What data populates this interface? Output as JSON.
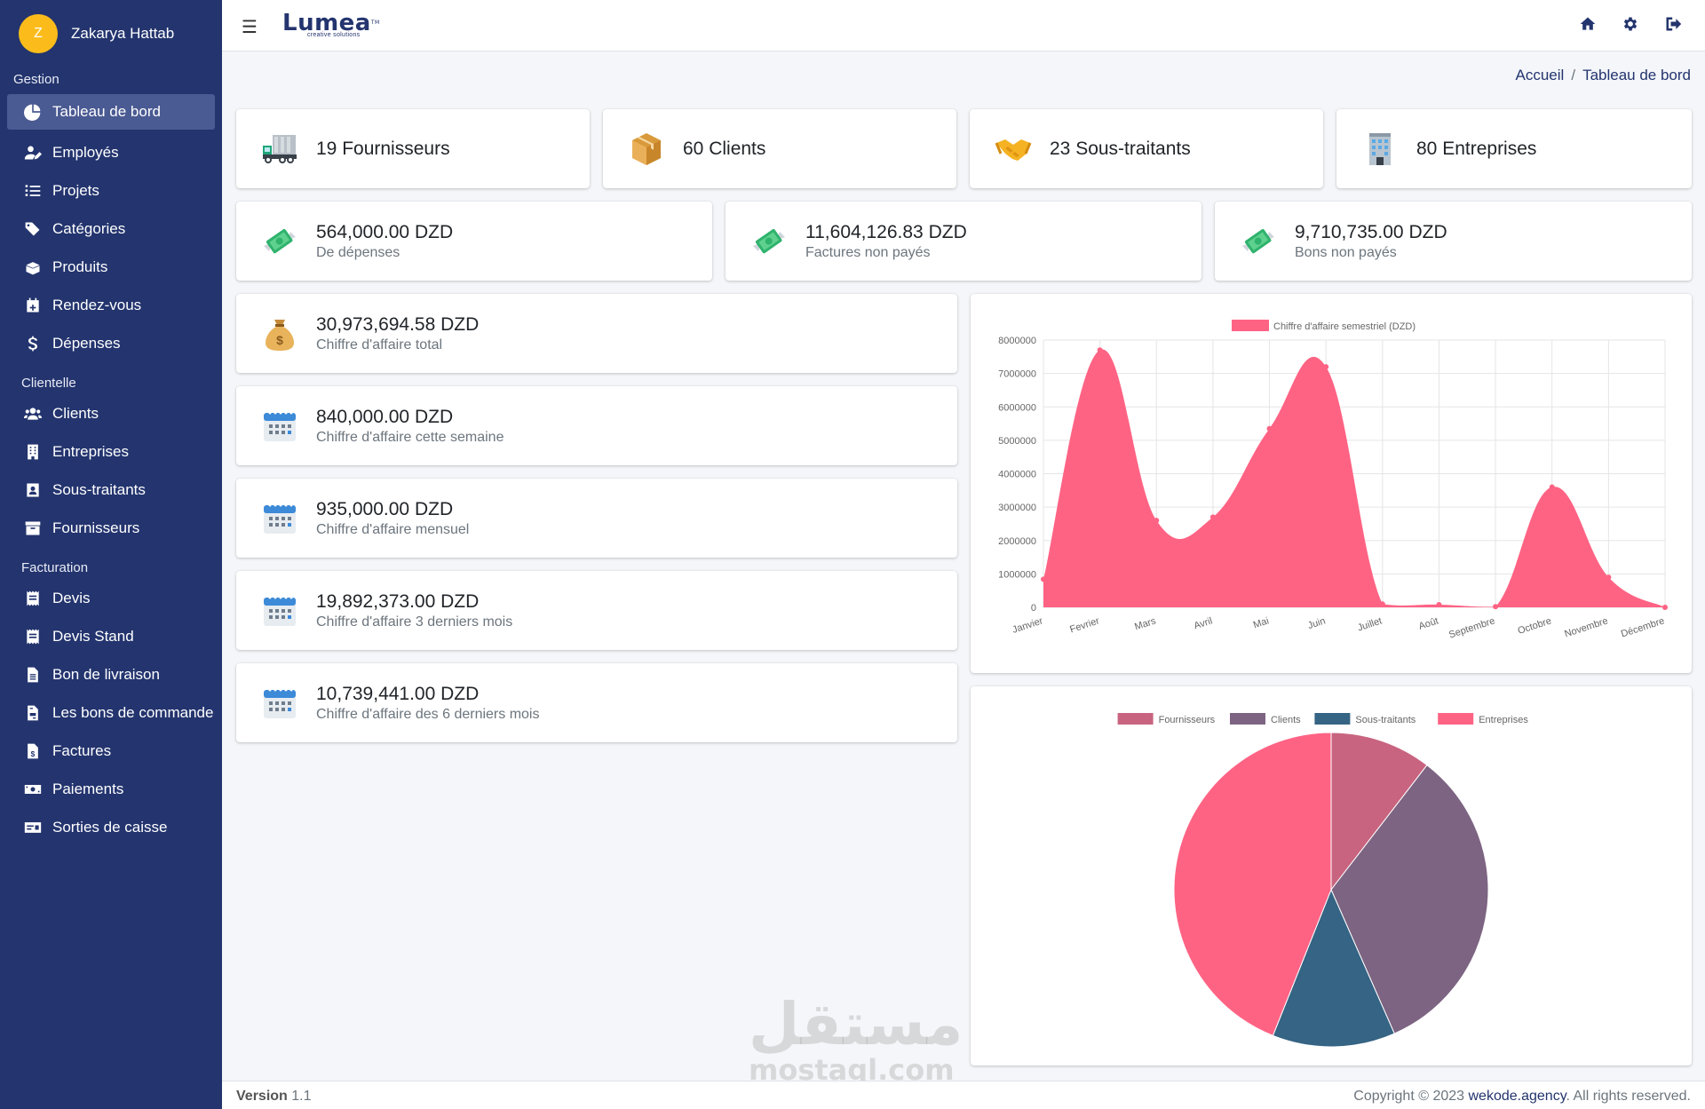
{
  "user": {
    "initial": "Z",
    "name": "Zakarya Hattab"
  },
  "sidebar": {
    "sections": [
      {
        "title": "Gestion",
        "items": [
          {
            "label": "Tableau de bord",
            "icon": "pie-chart-icon",
            "active": true
          },
          {
            "label": "Employés",
            "icon": "user-edit-icon"
          },
          {
            "label": "Projets",
            "icon": "tasks-icon"
          },
          {
            "label": "Catégories",
            "icon": "tags-icon"
          },
          {
            "label": "Produits",
            "icon": "box-open-icon"
          },
          {
            "label": "Rendez-vous",
            "icon": "calendar-plus-icon"
          },
          {
            "label": "Dépenses",
            "icon": "dollar-icon"
          }
        ]
      },
      {
        "title": "Clientelle",
        "items": [
          {
            "label": "Clients",
            "icon": "users-icon"
          },
          {
            "label": "Entreprises",
            "icon": "building-icon"
          },
          {
            "label": "Sous-traitants",
            "icon": "id-badge-icon"
          },
          {
            "label": "Fournisseurs",
            "icon": "archive-icon"
          }
        ]
      },
      {
        "title": "Facturation",
        "items": [
          {
            "label": "Devis",
            "icon": "receipt-icon"
          },
          {
            "label": "Devis Stand",
            "icon": "receipt-icon"
          },
          {
            "label": "Bon de livraison",
            "icon": "file-lines-icon"
          },
          {
            "label": "Les bons de commande",
            "icon": "file-invoice-icon"
          },
          {
            "label": "Factures",
            "icon": "file-invoice-dollar-icon"
          },
          {
            "label": "Paiements",
            "icon": "money-bill-icon"
          },
          {
            "label": "Sorties de caisse",
            "icon": "money-check-icon"
          }
        ]
      }
    ]
  },
  "topbar": {
    "logo": "Lumea",
    "logo_tm": "TM",
    "logo_sub": "creative solutions"
  },
  "breadcrumb": {
    "home": "Accueil",
    "separator": "/",
    "current": "Tableau de bord"
  },
  "stats_row1": [
    {
      "text": "19 Fournisseurs",
      "icon": "truck-icon"
    },
    {
      "text": "60 Clients",
      "icon": "box-icon"
    },
    {
      "text": "23 Sous-traitants",
      "icon": "handshake-icon"
    },
    {
      "text": "80 Entreprises",
      "icon": "office-building-icon"
    }
  ],
  "stats_row2": [
    {
      "amount": "564,000.00",
      "currency": "DZD",
      "label": "De dépenses",
      "icon": "money-wings-icon"
    },
    {
      "amount": "11,604,126.83",
      "currency": "DZD",
      "label": "Factures non payés",
      "icon": "money-wings-icon"
    },
    {
      "amount": "9,710,735.00",
      "currency": "DZD",
      "label": "Bons non payés",
      "icon": "money-wings-icon"
    }
  ],
  "stats_col": [
    {
      "amount": "30,973,694.58",
      "currency": "DZD",
      "label": "Chiffre d'affaire total",
      "icon": "money-bag-icon"
    },
    {
      "amount": "840,000.00",
      "currency": "DZD",
      "label": "Chiffre d'affaire cette semaine",
      "icon": "calendar-icon"
    },
    {
      "amount": "935,000.00",
      "currency": "DZD",
      "label": "Chiffre d'affaire mensuel",
      "icon": "calendar-icon"
    },
    {
      "amount": "19,892,373.00",
      "currency": "DZD",
      "label": "Chiffre d'affaire 3 derniers mois",
      "icon": "calendar-icon"
    },
    {
      "amount": "10,739,441.00",
      "currency": "DZD",
      "label": "Chiffre d'affaire des 6 derniers mois",
      "icon": "calendar-icon"
    }
  ],
  "chart_data": [
    {
      "type": "area",
      "title": "",
      "legend": "top",
      "grid": true,
      "series": [
        {
          "name": "Chiffre d'affaire semestriel (DZD)",
          "color": "#ff6384",
          "values": [
            840000,
            7700000,
            2600000,
            2700000,
            5350000,
            7200000,
            100000,
            80000,
            20000,
            3600000,
            900000,
            0
          ]
        }
      ],
      "categories": [
        "Janvier",
        "Fevrier",
        "Mars",
        "Avril",
        "Mai",
        "Juin",
        "Juillet",
        "Août",
        "Septembre",
        "Octobre",
        "Novembre",
        "Décembre"
      ],
      "ylim": [
        0,
        8000000
      ],
      "yticks": [
        "8000000",
        "7000000",
        "6000000",
        "5000000",
        "4000000",
        "3000000",
        "2000000",
        "1000000",
        "0"
      ]
    },
    {
      "type": "pie",
      "title": "",
      "legend": "top",
      "labels": [
        "Fournisseurs",
        "Clients",
        "Sous-traitants",
        "Entreprises"
      ],
      "values": [
        19,
        60,
        23,
        80
      ],
      "colors": [
        "#c8647f",
        "#7d6482",
        "#356484",
        "#ff6384"
      ]
    }
  ],
  "footer": {
    "version_label": "Version",
    "version": "1.1",
    "copyright_prefix": "Copyright © 2023",
    "company": "wekode.agency",
    "copyright_suffix": ". All rights reserved."
  },
  "watermark": {
    "arabic": "مستقل",
    "latin": "mostaql.com"
  }
}
